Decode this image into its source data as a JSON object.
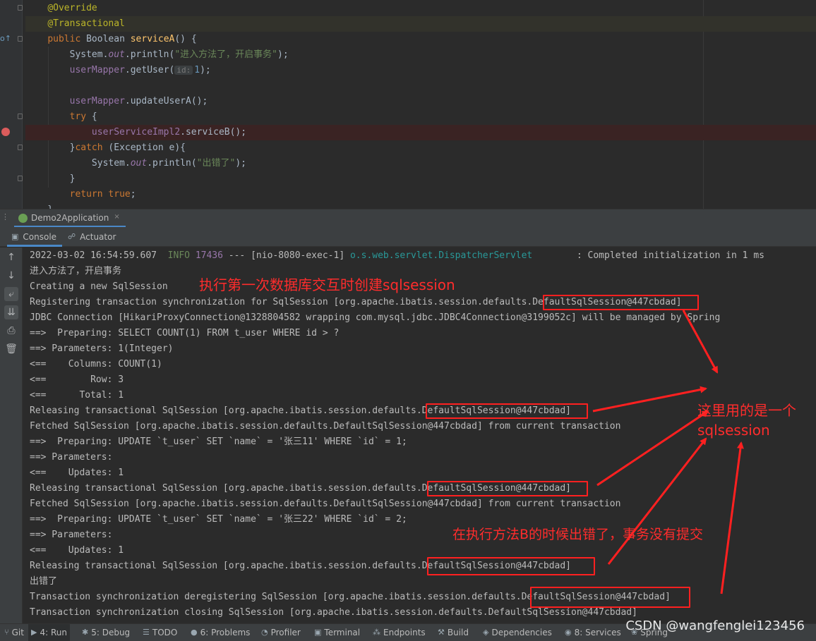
{
  "editor": {
    "lines": [
      {
        "id": "l1",
        "html": "<span class='an'>@Override</span>"
      },
      {
        "id": "l2",
        "html": "<span class='an'>@Transactional</span>"
      },
      {
        "id": "l3",
        "html": "<span class='kw'>public</span> Boolean <span class='fn'>serviceA</span>() {"
      },
      {
        "id": "l4",
        "html": "    System.<span class='st'>out</span>.println(<span class='str'>\"进入方法了，开启事务\"</span>);"
      },
      {
        "id": "l5",
        "html": "    <span class='fld'>userMapper</span>.getUser(<span class='hint'>id:</span><span class='num'>1</span>);"
      },
      {
        "id": "l6",
        "html": ""
      },
      {
        "id": "l7",
        "html": "    <span class='fld'>userMapper</span>.updateUserA();"
      },
      {
        "id": "l8",
        "html": "    <span class='kw'>try</span> {"
      },
      {
        "id": "l9",
        "html": "        <span class='fld'>userServiceImpl2</span>.serviceB();"
      },
      {
        "id": "l10",
        "html": "    }<span class='kw'>catch</span> (Exception e){"
      },
      {
        "id": "l11",
        "html": "        System.<span class='st'>out</span>.println(<span class='str'>\"出错了\"</span>);"
      },
      {
        "id": "l12",
        "html": "    }"
      },
      {
        "id": "l13",
        "html": "    <span class='kw'>return true</span>;"
      },
      {
        "id": "l14",
        "html": "}"
      }
    ]
  },
  "run_tab": {
    "label": "Demo2Application",
    "close": "×"
  },
  "subtabs": {
    "console": "Console",
    "actuator": "Actuator"
  },
  "console": {
    "lines": [
      {
        "html": "2022-03-02 16:54:59.607  <span class='log-green'>INFO</span> <span class='fld'>17436</span> --- [nio-8080-exec-1] <span class='log-teal'>o.s.web.servlet.DispatcherServlet</span>        : Completed initialization in 1 ms"
      },
      {
        "html": "进入方法了，开启事务"
      },
      {
        "html": "Creating a new SqlSession"
      },
      {
        "html": "Registering transaction synchronization for SqlSession [org.apache.ibatis.session.defaults.DefaultSqlSession@447cbdad]"
      },
      {
        "html": "JDBC Connection [HikariProxyConnection@1328804582 wrapping com.mysql.jdbc.JDBC4Connection@3199052c] will be managed by Spring"
      },
      {
        "html": "==>  Preparing: SELECT COUNT(1) FROM t_user WHERE id &gt; ?"
      },
      {
        "html": "==> Parameters: 1(Integer)"
      },
      {
        "html": "&lt;==    Columns: COUNT(1)"
      },
      {
        "html": "&lt;==        Row: 3"
      },
      {
        "html": "&lt;==      Total: 1"
      },
      {
        "html": "Releasing transactional SqlSession [org.apache.ibatis.session.defaults.DefaultSqlSession@447cbdad]"
      },
      {
        "html": "Fetched SqlSession [org.apache.ibatis.session.defaults.DefaultSqlSession@447cbdad] from current transaction"
      },
      {
        "html": "==>  Preparing: UPDATE `t_user` SET `name` = '张三11' WHERE `id` = 1;"
      },
      {
        "html": "==> Parameters: "
      },
      {
        "html": "&lt;==    Updates: 1"
      },
      {
        "html": "Releasing transactional SqlSession [org.apache.ibatis.session.defaults.DefaultSqlSession@447cbdad]"
      },
      {
        "html": "Fetched SqlSession [org.apache.ibatis.session.defaults.DefaultSqlSession@447cbdad] from current transaction"
      },
      {
        "html": "==>  Preparing: UPDATE `t_user` SET `name` = '张三22' WHERE `id` = 2;"
      },
      {
        "html": "==> Parameters: "
      },
      {
        "html": "&lt;==    Updates: 1"
      },
      {
        "html": "Releasing transactional SqlSession [org.apache.ibatis.session.defaults.DefaultSqlSession@447cbdad]"
      },
      {
        "html": "出错了"
      },
      {
        "html": "Transaction synchronization deregistering SqlSession [org.apache.ibatis.session.defaults.DefaultSqlSession@447cbdad]"
      },
      {
        "html": "Transaction synchronization closing SqlSession [org.apache.ibatis.session.defaults.DefaultSqlSession@447cbdad]"
      }
    ]
  },
  "annotations": {
    "note_create": "执行第一次数据库交互时创建sqlsession",
    "note_same_line1": "这里用的是一个",
    "note_same_line2": "sqlsession",
    "note_error": "在执行方法B的时候出错了，事务没有提交",
    "color": "#ff2020"
  },
  "statusbar": {
    "items": [
      {
        "id": "git",
        "icon": "branch-icon",
        "glyph": "⑂",
        "label": "Git"
      },
      {
        "id": "run",
        "icon": "run-icon",
        "glyph": "▶",
        "label": "4: Run"
      },
      {
        "id": "debug",
        "icon": "bug-icon",
        "glyph": "✱",
        "label": "5: Debug"
      },
      {
        "id": "todo",
        "icon": "list-icon",
        "glyph": "☰",
        "label": "TODO"
      },
      {
        "id": "problems",
        "icon": "warning-icon",
        "glyph": "●",
        "label": "6: Problems"
      },
      {
        "id": "profiler",
        "icon": "profiler-icon",
        "glyph": "◔",
        "label": "Profiler"
      },
      {
        "id": "terminal",
        "icon": "terminal-icon",
        "glyph": "▣",
        "label": "Terminal"
      },
      {
        "id": "endpoints",
        "icon": "endpoints-icon",
        "glyph": "⁂",
        "label": "Endpoints"
      },
      {
        "id": "build",
        "icon": "hammer-icon",
        "glyph": "⚒",
        "label": "Build"
      },
      {
        "id": "dependencies",
        "icon": "dependencies-icon",
        "glyph": "◈",
        "label": "Dependencies"
      },
      {
        "id": "services",
        "icon": "services-icon",
        "glyph": "◉",
        "label": "8: Services"
      },
      {
        "id": "spring",
        "icon": "spring-icon",
        "glyph": "❀",
        "label": "Spring"
      }
    ],
    "watermark": "CSDN @wangfenglei123456"
  }
}
